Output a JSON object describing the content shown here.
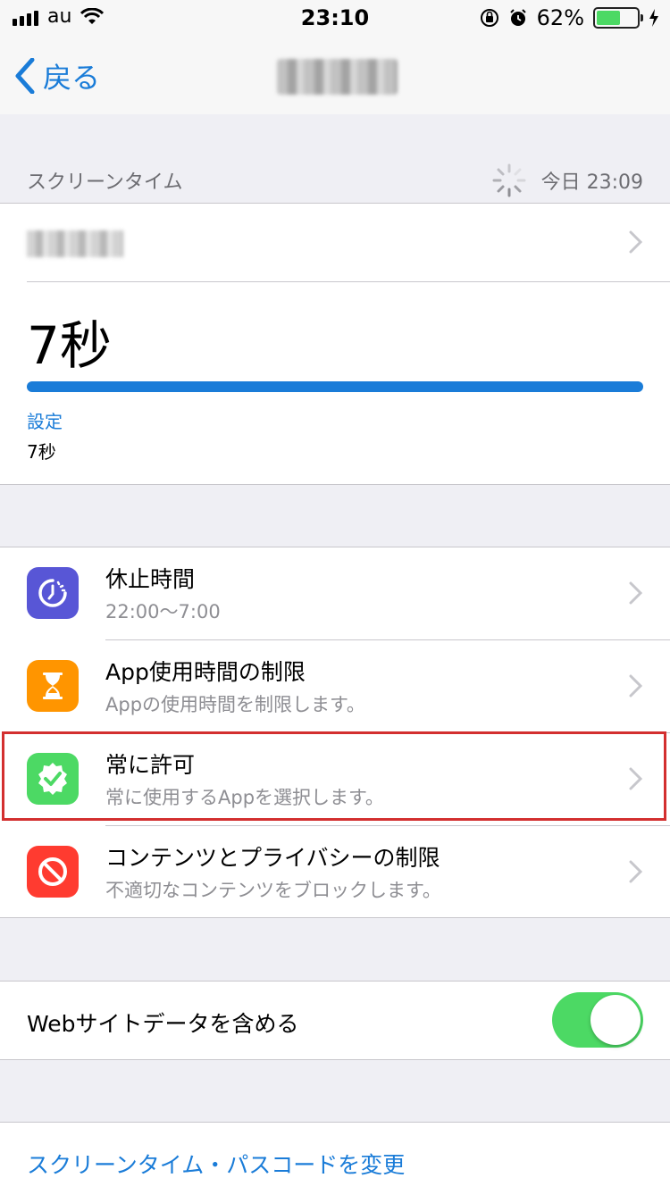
{
  "status_bar": {
    "carrier": "au",
    "time": "23:10",
    "battery_percent": "62%",
    "battery_level": 0.62,
    "icons": [
      "signal-icon",
      "wifi-icon",
      "orientation-lock-icon",
      "alarm-icon",
      "battery-icon",
      "charging-icon"
    ]
  },
  "nav": {
    "back_label": "戻る",
    "title_blurred": true
  },
  "screen_time": {
    "header_label": "スクリーンタイム",
    "updated": "今日 23:09",
    "device_name_blurred": true,
    "total_time": "7秒",
    "progress": 1.0,
    "category_label": "設定",
    "category_value": "7秒"
  },
  "menu": [
    {
      "title": "休止時間",
      "subtitle": "22:00〜7:00",
      "icon": "downtime-icon",
      "color": "#5856d6"
    },
    {
      "title": "App使用時間の制限",
      "subtitle": "Appの使用時間を制限します。",
      "icon": "hourglass-icon",
      "color": "#ff9500"
    },
    {
      "title": "常に許可",
      "subtitle": "常に使用するAppを選択します。",
      "icon": "checkmark-badge-icon",
      "color": "#4cd964",
      "highlighted": true
    },
    {
      "title": "コンテンツとプライバシーの制限",
      "subtitle": "不適切なコンテンツをブロックします。",
      "icon": "prohibited-icon",
      "color": "#ff3b30"
    }
  ],
  "website_data": {
    "label": "Webサイトデータを含める",
    "enabled": true
  },
  "passcode_link": "スクリーンタイム・パスコードを変更"
}
